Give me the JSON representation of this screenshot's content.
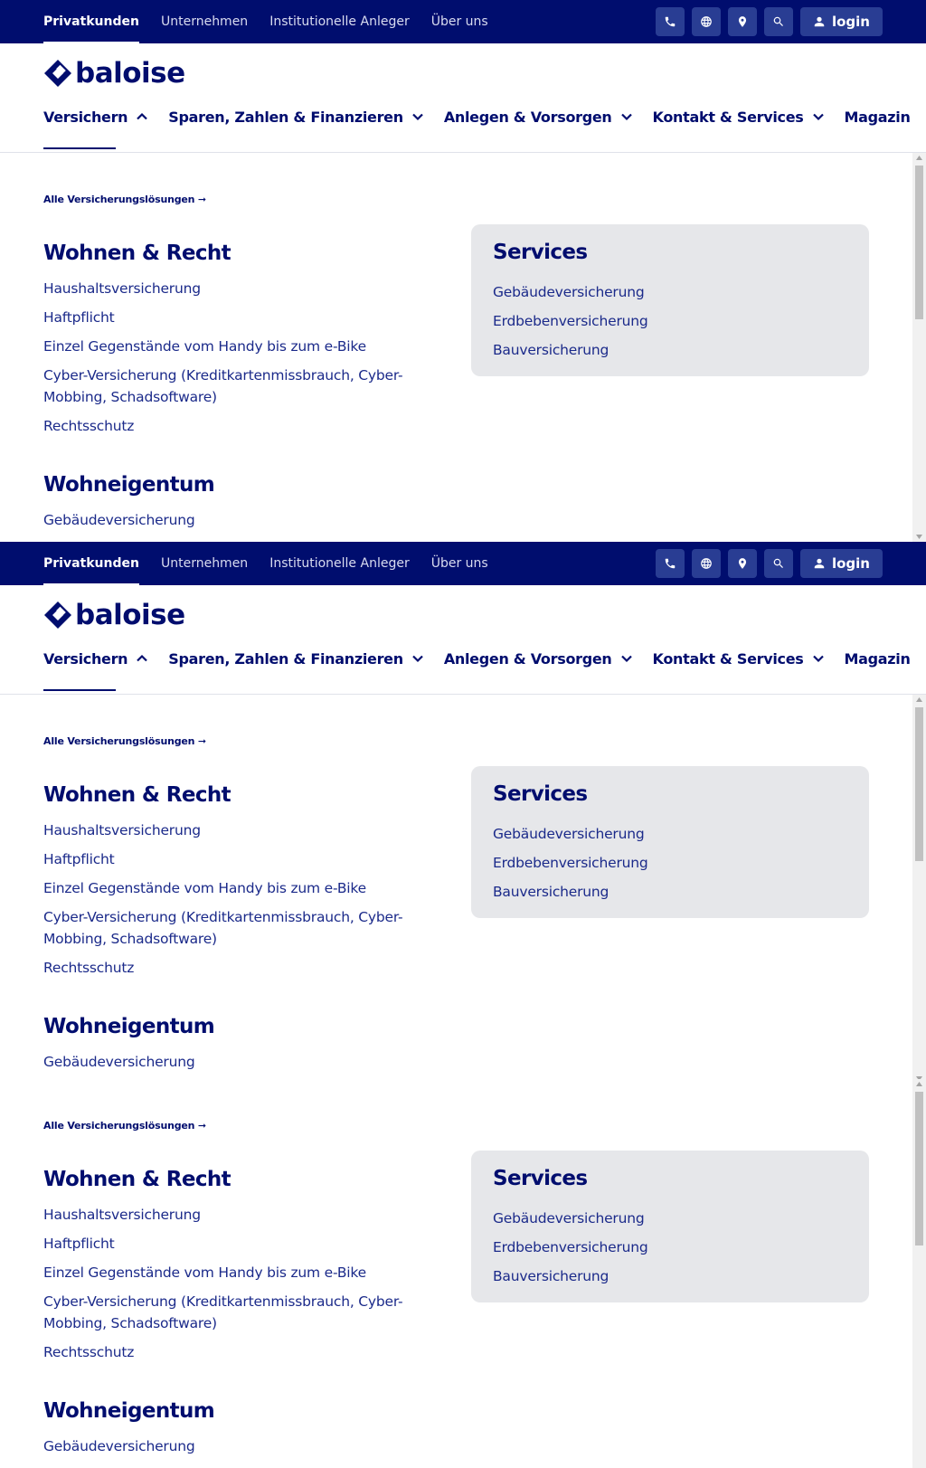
{
  "topnav": {
    "items": [
      "Privatkunden",
      "Unternehmen",
      "Institutionelle Anleger",
      "Über uns"
    ],
    "active_index": 0,
    "icons": [
      "phone-icon",
      "globe-icon",
      "location-pin-icon",
      "search-icon"
    ],
    "login_label": "login"
  },
  "brand": {
    "name": "baloise"
  },
  "mainnav": {
    "items": [
      {
        "label": "Versichern",
        "chevron": "up"
      },
      {
        "label": "Sparen, Zahlen & Finanzieren",
        "chevron": "down"
      },
      {
        "label": "Anlegen & Vorsorgen",
        "chevron": "down"
      },
      {
        "label": "Kontakt & Services",
        "chevron": "down"
      },
      {
        "label": "Magazin",
        "chevron": ""
      }
    ],
    "active_index": 0
  },
  "menu": {
    "all_solutions": "Alle Versicherungslösungen ➞",
    "wohnen": {
      "title": "Wohnen & Recht",
      "links": [
        "Haushaltsversicherung",
        "Haftpflicht",
        "Einzel Gegenstände vom Handy bis zum e-Bike",
        "Cyber-Versicherung (Kreditkartenmissbrauch, Cyber-",
        "Mobbing, Schadsoftware)",
        "Rechtsschutz"
      ]
    },
    "eigentum": {
      "title": "Wohneigentum",
      "links": [
        "Gebäudeversicherung"
      ]
    },
    "services": {
      "title": "Services",
      "links": [
        "Gebäudeversicherung",
        "Erdbebenversicherung",
        "Bauversicherung"
      ]
    }
  },
  "colors": {
    "brand_navy": "#000d6e",
    "link_blue": "#1b2a8a",
    "services_bg": "#e6e7ea"
  }
}
